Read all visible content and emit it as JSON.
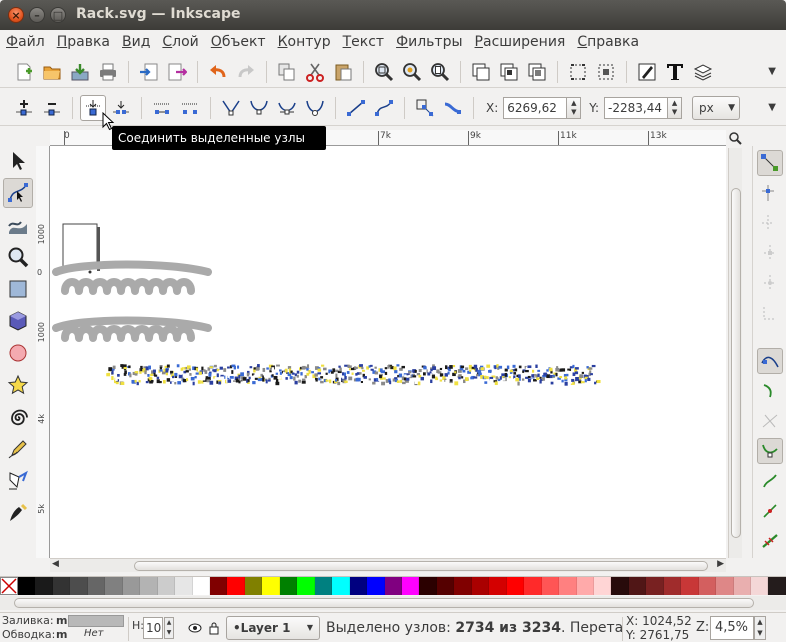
{
  "window": {
    "title": "Rack.svg — Inkscape",
    "close_glyph": "×",
    "min_glyph": "–",
    "max_glyph": "□"
  },
  "menu": [
    "Файл",
    "Правка",
    "Вид",
    "Слой",
    "Объект",
    "Контур",
    "Текст",
    "Фильтры",
    "Расширения",
    "Справка"
  ],
  "commands_toolbar": {
    "icons": [
      "new-document-icon",
      "open-file-icon",
      "save-icon",
      "print-icon",
      "import-icon",
      "export-icon",
      "undo-icon",
      "redo-icon",
      "duplicate-icon",
      "cut-icon",
      "paste-icon",
      "zoom-selection-icon",
      "zoom-drawing-icon",
      "zoom-page-icon",
      "group-icon",
      "ungroup-icon",
      "ungroup-selection-icon",
      "node-align-icon",
      "bounding-box-icon",
      "fill-stroke-icon",
      "text-font-icon",
      "layers-icon"
    ],
    "more_glyph": "▼"
  },
  "node_toolbar": {
    "icons": [
      "insert-node-icon",
      "delete-node-icon",
      "join-nodes-icon",
      "break-path-icon",
      "join-segment-icon",
      "delete-segment-icon",
      "cusp-node-icon",
      "smooth-node-icon",
      "symmetric-node-icon",
      "auto-smooth-node-icon",
      "line-segment-icon",
      "curve-segment-icon",
      "object-to-path-icon",
      "stroke-to-path-icon"
    ],
    "x_label": "X:",
    "x_value": "6269,62",
    "y_label": "Y:",
    "y_value": "-2283,44",
    "unit": "px",
    "unit_arrow": "▼",
    "more_glyph": "▼"
  },
  "tooltip": "Соединить выделенные узлы",
  "tools": [
    "selector",
    "node",
    "tweak",
    "zoom",
    "rectangle",
    "3d-box",
    "ellipse",
    "star",
    "spiral",
    "pencil",
    "pen",
    "calligraphy"
  ],
  "active_tool": "node",
  "ruler": {
    "top_labels": [
      "0",
      "7k",
      "9k",
      "11k",
      "13k"
    ],
    "left_labels": [
      "1000",
      "0",
      "1000",
      "4k",
      "5k"
    ]
  },
  "snap_controls": [
    "snap-toggle",
    "snap-bbox",
    "snap-bbox-edge",
    "snap-bbox-corner",
    "snap-bbox-midpoint",
    "snap-bbox-center",
    "snap-nodes",
    "snap-paths",
    "snap-intersection",
    "snap-cusp",
    "snap-smooth",
    "snap-midpoint",
    "snap-guide"
  ],
  "palette": [
    "#000000",
    "#1a1a1a",
    "#333333",
    "#4d4d4d",
    "#666666",
    "#808080",
    "#999999",
    "#b3b3b3",
    "#cccccc",
    "#e6e6e6",
    "#ffffff",
    "#800000",
    "#ff0000",
    "#808000",
    "#ffff00",
    "#008000",
    "#00ff00",
    "#008080",
    "#00ffff",
    "#000080",
    "#0000ff",
    "#800080",
    "#ff00ff",
    "#2b0000",
    "#550000",
    "#800000",
    "#aa0000",
    "#d40000",
    "#ff0000",
    "#ff2a2a",
    "#ff5555",
    "#ff8080",
    "#ffaaaa",
    "#ffd5d5",
    "#280b0b",
    "#501616",
    "#782121",
    "#a02c2c",
    "#c83737",
    "#d35f5f",
    "#de8787",
    "#e9afaf",
    "#f4d7d7",
    "#241c1c"
  ],
  "status": {
    "fill_label": "Заливка:",
    "fill_value": "m",
    "stroke_label": "Обводка:",
    "stroke_value": "m",
    "stroke_none": "Нет",
    "stroke_width": "10",
    "layer": "•Layer 1",
    "message_prefix": "Выделено узлов: ",
    "message_bold": "2734 из 3234",
    "message_suffix": ". Перетаски...",
    "x_coord": "X: 1024,52",
    "y_coord": "Y: 2761,75",
    "zoom_label": "Z:",
    "zoom_value": "4,5%"
  }
}
